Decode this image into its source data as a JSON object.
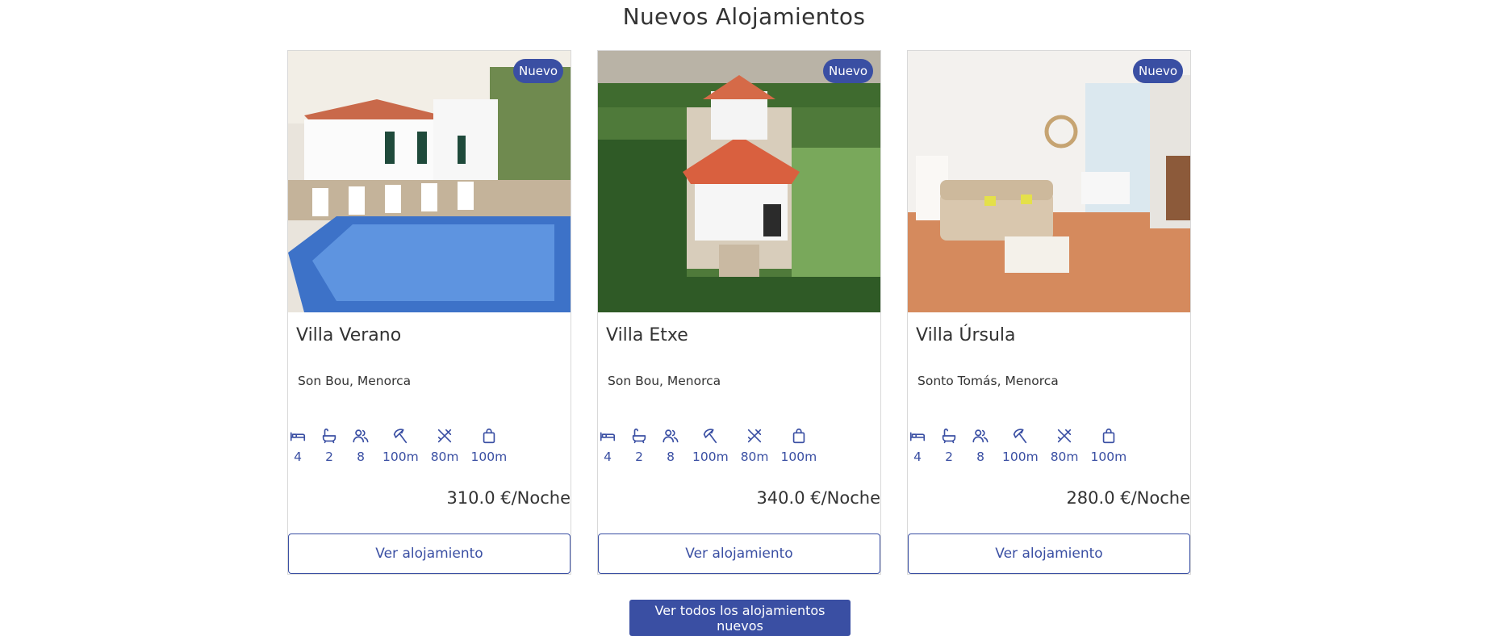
{
  "section": {
    "title": "Nuevos Alojamientos"
  },
  "colors": {
    "accent": "#3a4fa3"
  },
  "cards": [
    {
      "badge": "Nuevo",
      "title": "Villa Verano",
      "location": "Son Bou, Menorca",
      "amenities": [
        {
          "icon": "bed-icon",
          "value": "4"
        },
        {
          "icon": "bathtub-icon",
          "value": "2"
        },
        {
          "icon": "guests-icon",
          "value": "8"
        },
        {
          "icon": "beach-icon",
          "value": "100m"
        },
        {
          "icon": "restaurant-icon",
          "value": "80m"
        },
        {
          "icon": "shopping-bag-icon",
          "value": "100m"
        }
      ],
      "price": "310.0 €/Noche",
      "button": "Ver alojamiento"
    },
    {
      "badge": "Nuevo",
      "title": "Villa Etxe",
      "location": "Son Bou, Menorca",
      "amenities": [
        {
          "icon": "bed-icon",
          "value": "4"
        },
        {
          "icon": "bathtub-icon",
          "value": "2"
        },
        {
          "icon": "guests-icon",
          "value": "8"
        },
        {
          "icon": "beach-icon",
          "value": "100m"
        },
        {
          "icon": "restaurant-icon",
          "value": "80m"
        },
        {
          "icon": "shopping-bag-icon",
          "value": "100m"
        }
      ],
      "price": "340.0 €/Noche",
      "button": "Ver alojamiento"
    },
    {
      "badge": "Nuevo",
      "title": "Villa Úrsula",
      "location": "Sonto Tomás, Menorca",
      "amenities": [
        {
          "icon": "bed-icon",
          "value": "4"
        },
        {
          "icon": "bathtub-icon",
          "value": "2"
        },
        {
          "icon": "guests-icon",
          "value": "8"
        },
        {
          "icon": "beach-icon",
          "value": "100m"
        },
        {
          "icon": "restaurant-icon",
          "value": "80m"
        },
        {
          "icon": "shopping-bag-icon",
          "value": "100m"
        }
      ],
      "price": "280.0 €/Noche",
      "button": "Ver alojamiento"
    }
  ],
  "all_button": "Ver todos los alojamientos nuevos"
}
